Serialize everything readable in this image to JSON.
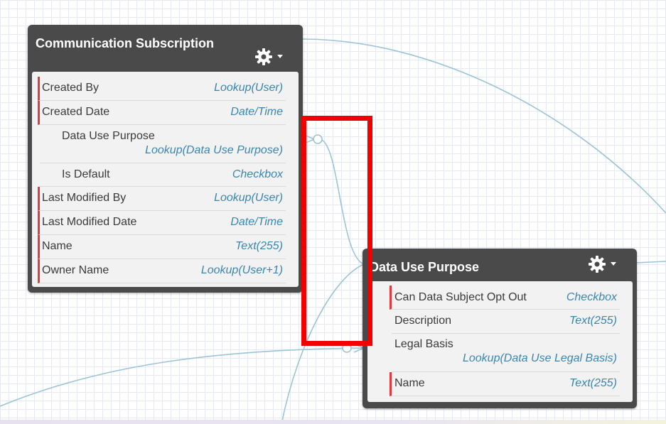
{
  "objects": [
    {
      "title": "Communication Subscription",
      "fields": [
        {
          "name": "Created By",
          "type": "Lookup(User)",
          "required": true
        },
        {
          "name": "Created Date",
          "type": "Date/Time",
          "required": true
        },
        {
          "name": "Data Use Purpose",
          "type": "Lookup(Data Use Purpose)",
          "required": false
        },
        {
          "name": "Is Default",
          "type": "Checkbox",
          "required": false
        },
        {
          "name": "Last Modified By",
          "type": "Lookup(User)",
          "required": true
        },
        {
          "name": "Last Modified Date",
          "type": "Date/Time",
          "required": true
        },
        {
          "name": "Name",
          "type": "Text(255)",
          "required": true
        },
        {
          "name": "Owner Name",
          "type": "Lookup(User+1)",
          "required": true
        }
      ]
    },
    {
      "title": "Data Use Purpose",
      "fields": [
        {
          "name": "Can Data Subject Opt Out",
          "type": "Checkbox",
          "required": true
        },
        {
          "name": "Description",
          "type": "Text(255)",
          "required": false
        },
        {
          "name": "Legal Basis",
          "type": "Lookup(Data Use Legal Basis)",
          "required": false
        },
        {
          "name": "Name",
          "type": "Text(255)",
          "required": true
        }
      ]
    }
  ],
  "colors": {
    "header": "#4a4a4a",
    "body": "#f2f2f2",
    "required_marker": "#e03a3e",
    "field_type": "#3a86b0",
    "connector": "#9cc4d4",
    "highlight": "#f20000"
  },
  "icons": {
    "object_menu": "gear-dropdown-icon"
  }
}
